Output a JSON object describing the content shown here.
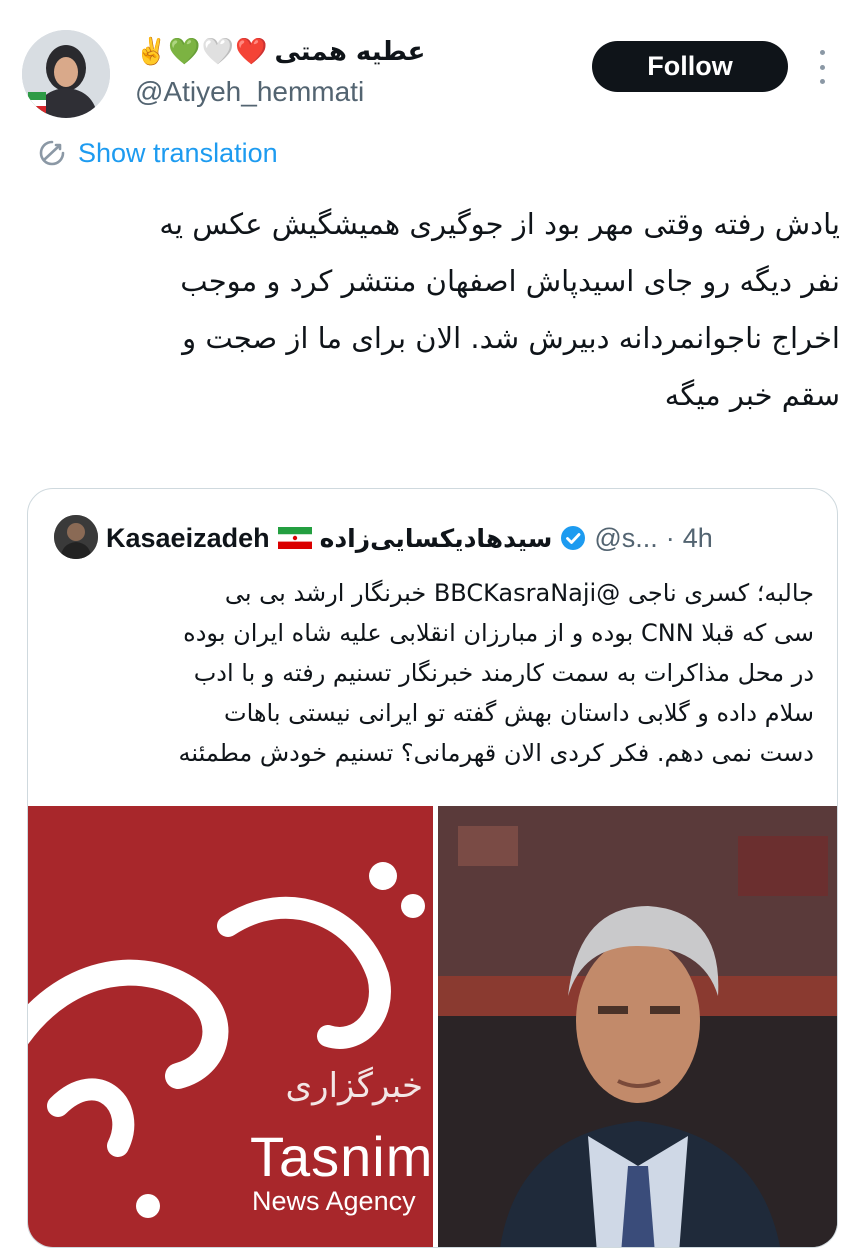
{
  "author": {
    "display_name": "عطیه همتی",
    "emojis": "✌️💚🤍❤️",
    "handle": "@Atiyeh_hemmati"
  },
  "actions": {
    "follow_label": "Follow",
    "more_icon": "more-vertical-icon"
  },
  "translation": {
    "label": "Show translation",
    "icon": "translate-icon"
  },
  "tweet": {
    "lines": [
      "یادش رفته وقتی مهر بود از جوگیری همیشگیش عکس یه",
      "نفر دیگه رو جای اسیدپاش اصفهان منتشر کرد و موجب",
      "اخراج ناجوانمردانه دبیرش شد. الان برای ما از صجت و",
      "سقم خبر میگه"
    ]
  },
  "quote": {
    "name_en": "Kasaeizadeh",
    "name_fa": "سیدهادیکسایی‌زاده",
    "handle": "@s...",
    "dot": "·",
    "time": "4h",
    "lines": [
      "جالبه؛ کسری ناجی @BBCKasraNaji خبرنگار ارشد بی بی",
      "سی که قبلا CNN بوده و از مبارزان انقلابی علیه شاه ایران بوده",
      "در محل مذاکرات به سمت کارمند خبرنگار تسنیم رفته و با ادب",
      "سلام داده و گلابی داستان بهش گفته تو ایرانی نیستی باهات",
      "دست نمی دهم. فکر کردی الان قهرمانی؟ تسنیم خودش مطمئنه"
    ],
    "media": {
      "left_brand_fa": "خبرگزاری",
      "left_brand_en": "Tasnim",
      "left_brand_sub": "News Agency"
    }
  },
  "colors": {
    "accent": "#1d9bf0",
    "follow_bg": "#0f1419",
    "secondary_text": "#536471",
    "border": "#cfd9de",
    "tasnim_red": "#a8272b"
  }
}
